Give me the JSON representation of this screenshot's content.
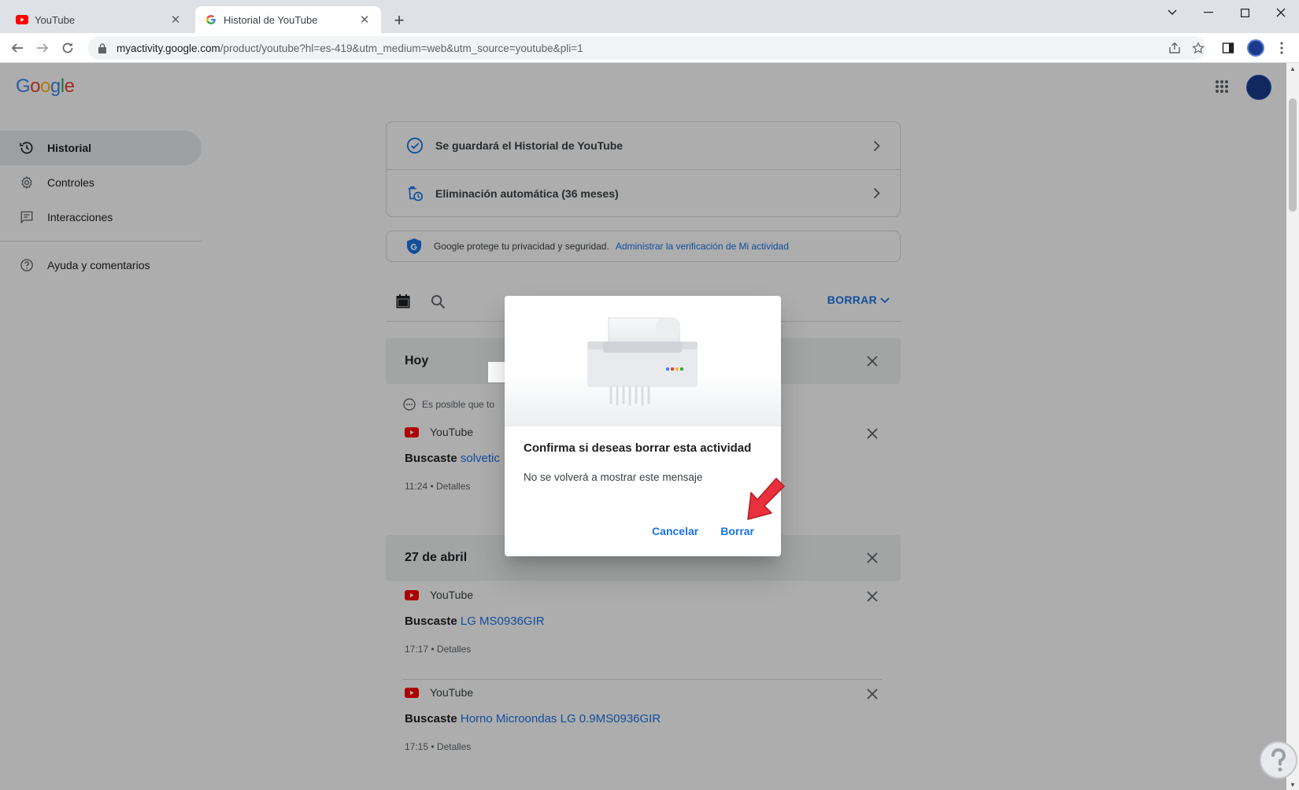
{
  "browser": {
    "tabs": [
      {
        "title": "YouTube",
        "favicon": "youtube-icon",
        "active": false
      },
      {
        "title": "Historial de YouTube",
        "favicon": "google-g-icon",
        "active": true
      }
    ],
    "url_host": "myactivity.google.com",
    "url_path": "/product/youtube?hl=es-419&utm_medium=web&utm_source=youtube&pli=1"
  },
  "header": {
    "logo_letters": [
      "G",
      "o",
      "o",
      "g",
      "l",
      "e"
    ],
    "logo_colors": [
      "#4285F4",
      "#EA4335",
      "#FBBC05",
      "#4285F4",
      "#34A853",
      "#EA4335"
    ]
  },
  "sidebar": {
    "items": [
      {
        "label": "Historial",
        "icon": "history-icon",
        "active": true
      },
      {
        "label": "Controles",
        "icon": "gear-icon",
        "active": false
      },
      {
        "label": "Interacciones",
        "icon": "feedback-icon",
        "active": false
      }
    ],
    "help": {
      "label": "Ayuda y comentarios",
      "icon": "help-circle-icon"
    }
  },
  "settings_card": {
    "rows": [
      {
        "label": "Se guardará el Historial de YouTube",
        "icon": "check-circle-icon"
      },
      {
        "label": "Eliminación automática (36 meses)",
        "icon": "auto-delete-icon"
      }
    ]
  },
  "privacy": {
    "text": "Google protege tu privacidad y seguridad.",
    "link": "Administrar la verificación de Mi actividad"
  },
  "filter": {
    "delete_menu_label": "BORRAR"
  },
  "groups": [
    {
      "header": "Hoy",
      "note": "Es posible que to",
      "entries": [
        {
          "source": "YouTube",
          "prefix": "Buscaste",
          "query": "solvetic",
          "time": "11:24",
          "details": "Detalles"
        }
      ]
    },
    {
      "header": "27 de abril",
      "entries": [
        {
          "source": "YouTube",
          "prefix": "Buscaste",
          "query": "LG MS0936GIR",
          "time": "17:17",
          "details": "Detalles"
        },
        {
          "source": "YouTube",
          "prefix": "Buscaste",
          "query": "Horno Microondas LG 0.9MS0936GIR",
          "time": "17:15",
          "details": "Detalles"
        }
      ]
    }
  ],
  "dialog": {
    "title": "Confirma si deseas borrar esta actividad",
    "message": "No se volverá a mostrar este mensaje",
    "cancel": "Cancelar",
    "confirm": "Borrar"
  },
  "colors": {
    "accent": "#1a73e8",
    "pointer_arrow": "#e8313d",
    "youtube_red": "#ff0000"
  }
}
